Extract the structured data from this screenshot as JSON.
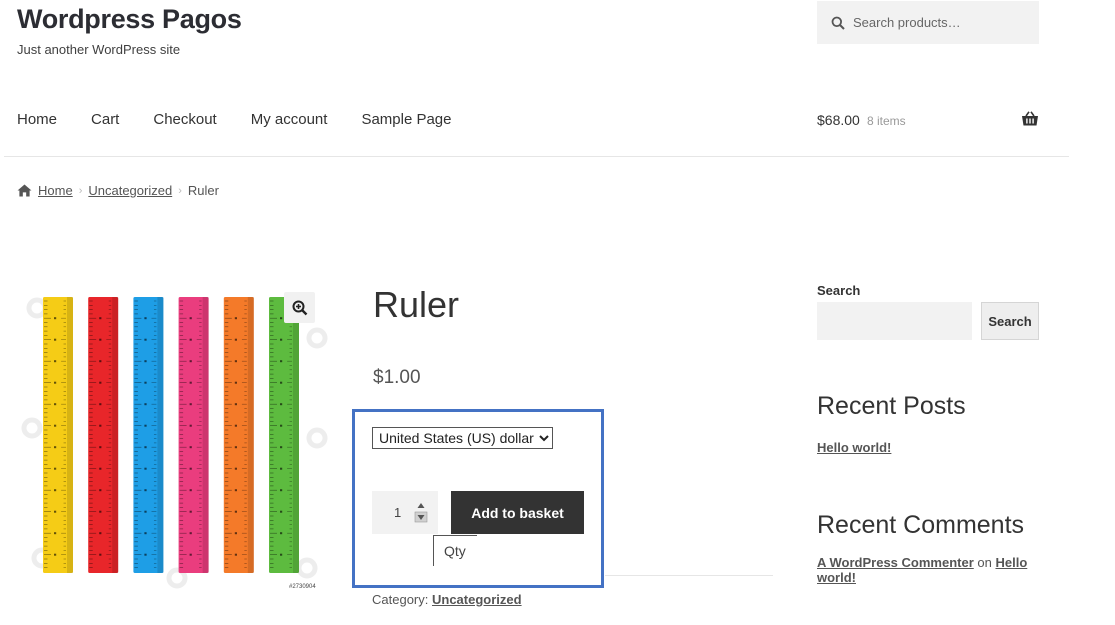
{
  "site": {
    "title": "Wordpress Pagos",
    "description": "Just another WordPress site"
  },
  "header_search": {
    "placeholder": "Search products…",
    "icon": "search-icon"
  },
  "nav": {
    "items": [
      {
        "label": "Home"
      },
      {
        "label": "Cart"
      },
      {
        "label": "Checkout"
      },
      {
        "label": "My account"
      },
      {
        "label": "Sample Page"
      }
    ]
  },
  "cart": {
    "amount": "$68.00",
    "count": "8 items",
    "icon": "basket-icon"
  },
  "breadcrumb": {
    "home": "Home",
    "category": "Uncategorized",
    "current": "Ruler",
    "separator": "›"
  },
  "product": {
    "title": "Ruler",
    "price": "$1.00",
    "currency_selected": "United States (US) dollar",
    "quantity": "1",
    "add_button": "Add to basket",
    "qty_tooltip": "Qty",
    "category_label": "Category:",
    "category": "Uncategorized",
    "image_code": "#2730904",
    "ruler_colors": [
      "#f5cc16",
      "#e8262a",
      "#1e9ee6",
      "#ea3d7e",
      "#f47a29",
      "#5dbb3f"
    ]
  },
  "sidebar": {
    "search_label": "Search",
    "search_button": "Search",
    "recent_posts_title": "Recent Posts",
    "recent_posts": [
      "Hello world!"
    ],
    "recent_comments_title": "Recent Comments",
    "comment": {
      "author": "A WordPress Commenter",
      "on": "on",
      "post": "Hello world!"
    }
  },
  "highlight_color": "#4472c4"
}
